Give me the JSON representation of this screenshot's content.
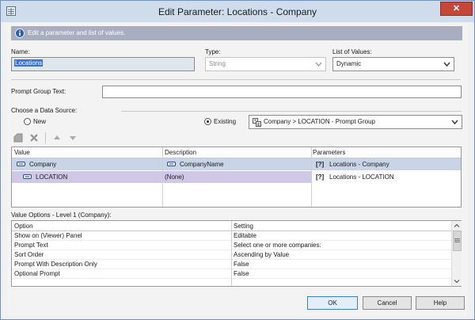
{
  "window": {
    "title": "Edit Parameter: Locations - Company"
  },
  "info_bar": {
    "text": "Edit a parameter and list of values."
  },
  "name": {
    "label": "Name:",
    "value": "Locations"
  },
  "type": {
    "label": "Type:",
    "value": "String"
  },
  "list_of_values": {
    "label": "List of Values:",
    "value": "Dynamic"
  },
  "prompt_group_text": {
    "label": "Prompt Group Text:",
    "value": ""
  },
  "data_source": {
    "label": "Choose a Data Source:",
    "new_label": "New",
    "existing_label": "Existing",
    "selected": "existing",
    "existing_value": "Company > LOCATION - Prompt Group"
  },
  "values_grid": {
    "columns": [
      "Value",
      "Description",
      "Parameters"
    ],
    "rows": [
      {
        "value": "Company",
        "description": "CompanyName",
        "parameters": "Locations - Company",
        "selected": true
      },
      {
        "value": "LOCATION",
        "description": "(None)",
        "parameters": "Locations - LOCATION",
        "selected": false
      }
    ],
    "param_glyph": "[?]"
  },
  "value_options": {
    "label": "Value Options - Level 1 (Company):",
    "columns": [
      "Option",
      "Setting"
    ],
    "rows": [
      {
        "option": "Show on (Viewer) Panel",
        "setting": "Editable"
      },
      {
        "option": "Prompt Text",
        "setting": "Select one or more companies:"
      },
      {
        "option": "Sort Order",
        "setting": "Ascending by Value"
      },
      {
        "option": "Prompt With Description Only",
        "setting": "False"
      },
      {
        "option": "Optional Prompt",
        "setting": "False"
      }
    ]
  },
  "buttons": {
    "ok": "OK",
    "cancel": "Cancel",
    "help": "Help"
  },
  "colors": {
    "info_bar": "#a9adc0",
    "selected_row": "#c9d4e6",
    "second_row": "#cfc8e6",
    "titlebar": "#cfdcec",
    "close": "#c7463a"
  },
  "icons": [
    "app-icon",
    "close-icon",
    "info-icon",
    "add-icon",
    "delete-icon",
    "move-up-icon",
    "move-down-icon",
    "prompt-group-icon",
    "field-icon",
    "chevron-down-icon"
  ]
}
